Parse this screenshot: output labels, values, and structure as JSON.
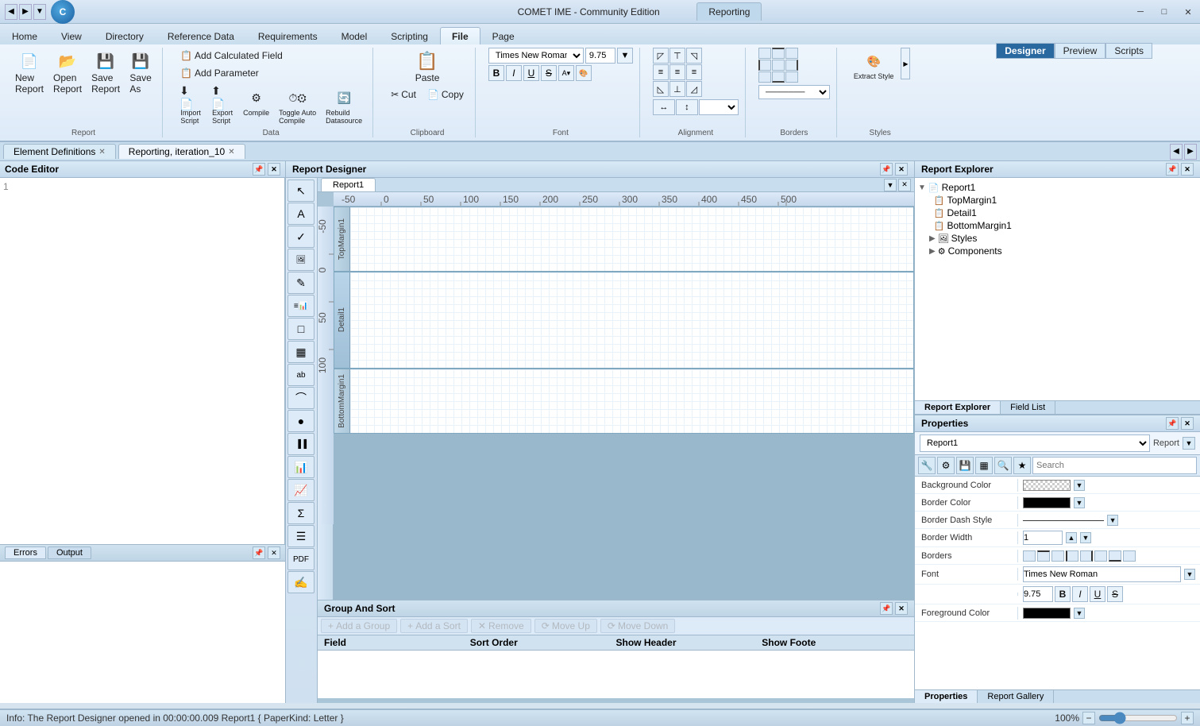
{
  "app": {
    "title": "COMET IME - Community Edition",
    "reporting_tab": "Reporting",
    "icon_letter": "C"
  },
  "win_controls": {
    "minimize": "─",
    "maximize": "□",
    "close": "✕"
  },
  "ribbon": {
    "tabs": [
      "Home",
      "View",
      "Directory",
      "Reference Data",
      "Requirements",
      "Model",
      "Scripting",
      "File",
      "Page"
    ],
    "active_tab": "File",
    "designer_btn": "Designer",
    "preview_btn": "Preview",
    "scripts_btn": "Scripts"
  },
  "ribbon_groups": {
    "report": {
      "label": "Report",
      "buttons": [
        "New Report",
        "Open Report",
        "Save Report",
        "Save As"
      ]
    },
    "data": {
      "label": "Data",
      "buttons": [
        "Import Script",
        "Export Script",
        "Compile",
        "Toggle Auto Compile",
        "Rebuild Datasource"
      ],
      "add_calculated": "Add Calculated Field",
      "add_parameter": "Add Parameter"
    },
    "clipboard": {
      "label": "Clipboard",
      "buttons": [
        "Cut",
        "Copy",
        "Paste"
      ]
    },
    "font": {
      "label": "Font",
      "name": "Times New Roman",
      "size": "9.75",
      "bold": "B",
      "italic": "I",
      "underline": "U",
      "strikethrough": "S"
    },
    "alignment": {
      "label": "Alignment"
    },
    "borders": {
      "label": "Borders"
    },
    "styles": {
      "label": "Styles",
      "extract_style": "Extract Style"
    }
  },
  "doc_tabs": [
    {
      "label": "Element Definitions",
      "active": false
    },
    {
      "label": "Reporting, iteration_10",
      "active": true
    }
  ],
  "left_panel": {
    "title": "Code Editor",
    "line_numbers": [
      "1"
    ]
  },
  "errors_panel": {
    "tabs": [
      "Errors",
      "Output"
    ],
    "active_tab": "Errors"
  },
  "designer": {
    "title": "Report Designer",
    "report_name": "Report1",
    "bands": [
      {
        "name": "TopMargin1",
        "type": "top-margin"
      },
      {
        "name": "Detail1",
        "type": "detail"
      },
      {
        "name": "BottomMargin1",
        "type": "bottom-margin"
      }
    ]
  },
  "toolbox": {
    "tools": [
      "↖",
      "A",
      "✓",
      "≡",
      "✎",
      "🖼",
      "□",
      "▦",
      "ab",
      "⌒",
      "●",
      "▐▐▐",
      "📊",
      "📈",
      "Σ",
      "☰",
      "PDF",
      "✍"
    ]
  },
  "group_sort": {
    "title": "Group And Sort",
    "toolbar": {
      "add_group": "Add a Group",
      "add_sort": "Add a Sort",
      "remove": "Remove",
      "move_up": "Move Up",
      "move_down": "Move Down"
    },
    "columns": [
      "Field",
      "Sort Order",
      "Show Header",
      "Show Foote"
    ]
  },
  "right_panel": {
    "explorer_title": "Report Explorer",
    "tree": {
      "root": "Report1",
      "children": [
        {
          "label": "TopMargin1",
          "icon": "page"
        },
        {
          "label": "Detail1",
          "icon": "page"
        },
        {
          "label": "BottomMargin1",
          "icon": "page"
        }
      ],
      "styles": "Styles",
      "components": "Components"
    },
    "explorer_tabs": [
      "Report Explorer",
      "Field List"
    ]
  },
  "properties": {
    "title": "Properties",
    "selector_label": "Report1",
    "selector_type": "Report",
    "search_placeholder": "Search",
    "props": [
      {
        "name": "Background Color",
        "value": "checkers"
      },
      {
        "name": "Border Color",
        "value": "black"
      },
      {
        "name": "Border Dash Style",
        "value": ""
      },
      {
        "name": "Border Width",
        "value": "1"
      },
      {
        "name": "Borders",
        "value": "borders_checkboxes"
      },
      {
        "name": "Font",
        "value": "Times New Roman"
      },
      {
        "name": "font_size_row",
        "value": "9.75"
      },
      {
        "name": "Foreground Color",
        "value": "black"
      }
    ],
    "font_name": "Times New Roman",
    "font_size": "9.75",
    "bottom_tabs": [
      "Properties",
      "Report Gallery"
    ],
    "active_bottom_tab": "Properties"
  },
  "status_bar": {
    "text": "Info: The Report Designer opened in 00:00:00.009   Report1 { PaperKind: Letter }",
    "zoom": "100%"
  }
}
